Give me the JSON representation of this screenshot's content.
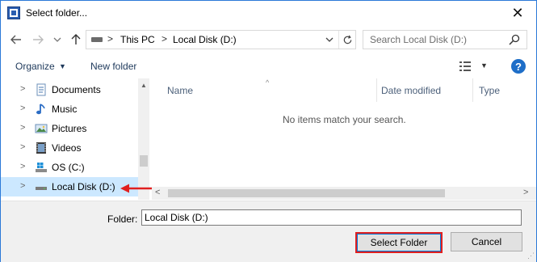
{
  "window": {
    "title": "Select folder...",
    "close_glyph": "✕"
  },
  "nav": {
    "back_icon": "arrow-left-icon",
    "forward_icon": "arrow-right-icon",
    "recent_icon": "chevron-down-icon",
    "up_icon": "arrow-up-icon",
    "breadcrumb": [
      "This PC",
      "Local Disk (D:)"
    ],
    "breadcrumb_separator": ">",
    "search_placeholder": "Search Local Disk (D:)"
  },
  "toolbar": {
    "organize_label": "Organize",
    "new_folder_label": "New folder",
    "help_label": "?"
  },
  "tree": {
    "items": [
      {
        "label": "Documents",
        "icon": "documents-icon",
        "selected": false
      },
      {
        "label": "Music",
        "icon": "music-icon",
        "selected": false
      },
      {
        "label": "Pictures",
        "icon": "pictures-icon",
        "selected": false
      },
      {
        "label": "Videos",
        "icon": "videos-icon",
        "selected": false
      },
      {
        "label": "OS (C:)",
        "icon": "windows-drive-icon",
        "selected": false
      },
      {
        "label": "Local Disk (D:)",
        "icon": "drive-icon",
        "selected": true
      }
    ]
  },
  "file_list": {
    "columns": [
      "Name",
      "Date modified",
      "Type"
    ],
    "empty_message": "No items match your search."
  },
  "bottom": {
    "folder_label": "Folder:",
    "folder_value": "Local Disk (D:)",
    "select_button": "Select Folder",
    "cancel_button": "Cancel"
  },
  "colors": {
    "accent": "#0078d7",
    "highlight_red": "#e02020",
    "selection": "#cce8ff"
  }
}
